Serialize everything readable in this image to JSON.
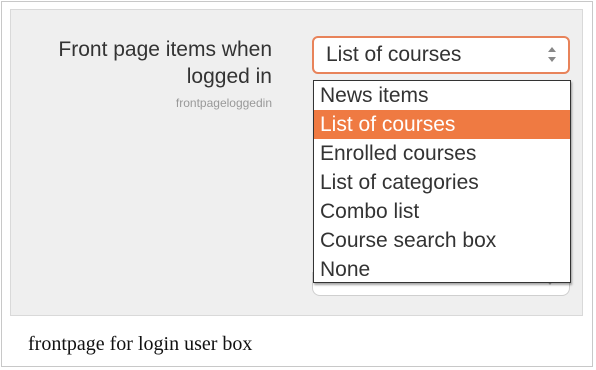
{
  "setting": {
    "label": "Front page items when logged in",
    "key": "frontpageloggedin"
  },
  "select": {
    "value": "List of courses",
    "ghost_value": "None",
    "options": [
      {
        "label": "News items",
        "selected": false
      },
      {
        "label": "List of courses",
        "selected": true
      },
      {
        "label": "Enrolled courses",
        "selected": false
      },
      {
        "label": "List of categories",
        "selected": false
      },
      {
        "label": "Combo list",
        "selected": false
      },
      {
        "label": "Course search box",
        "selected": false
      },
      {
        "label": "None",
        "selected": false
      }
    ]
  },
  "caption": "frontpage for login user box",
  "colors": {
    "accent": "#ef7a42",
    "focus_border": "#e8835a",
    "panel_bg": "#efefef"
  },
  "icons": {
    "select_arrows": "updown-arrows-icon",
    "ghost_arrow": "chevron-down-icon"
  }
}
